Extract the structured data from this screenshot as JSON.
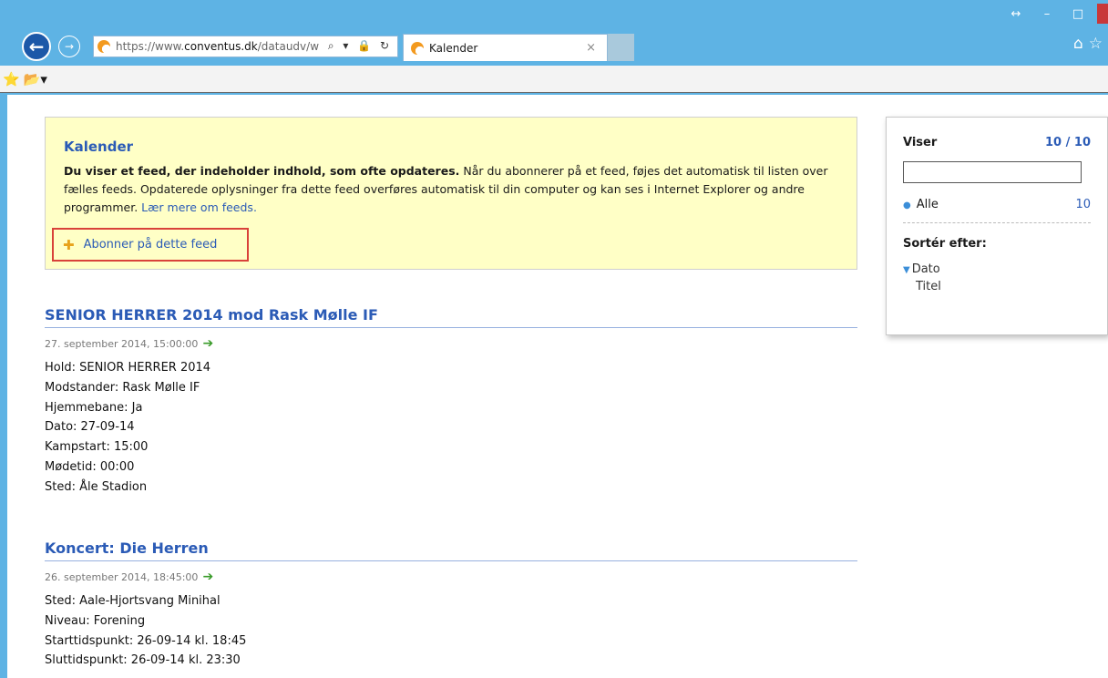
{
  "browser": {
    "url_prefix": "https://www.",
    "url_host": "conventus.dk",
    "url_path": "/dataudv/w",
    "tab_title": "Kalender",
    "tab_close": "×",
    "addr_icons": "⌕ ▾ 🔒 ↻",
    "back": "←",
    "forward": "→",
    "window_icons": [
      "↔",
      "–",
      "□"
    ]
  },
  "infobox": {
    "title": "Kalender",
    "bold_text": "Du viser et feed, der indeholder indhold, som ofte opdateres.",
    "text": " Når du abonnerer på et feed, føjes det automatisk til listen over fælles feeds. Opdaterede oplysninger fra dette feed overføres automatisk til din computer og kan ses i Internet Explorer og andre programmer. ",
    "link": "Lær mere om feeds.",
    "subscribe": "Abonner på dette feed"
  },
  "posts": [
    {
      "title": "SENIOR HERRER 2014 mod Rask Mølle IF",
      "date": "27. september 2014, 15:00:00",
      "lines": [
        "Hold: SENIOR HERRER 2014",
        "Modstander: Rask Mølle IF",
        "Hjemmebane: Ja",
        "Dato: 27-09-14",
        "Kampstart: 15:00",
        "Mødetid: 00:00",
        "Sted: Åle Stadion"
      ]
    },
    {
      "title": "Koncert: Die Herren",
      "date": "26. september 2014, 18:45:00",
      "lines": [
        "Sted: Aale-Hjortsvang Minihal",
        "Niveau: Forening",
        "Starttidspunkt: 26-09-14 kl. 18:45",
        "Sluttidspunkt: 26-09-14 kl. 23:30"
      ]
    }
  ],
  "sidebar": {
    "viser_label": "Viser",
    "viser_count": "10 / 10",
    "alle_label": "Alle",
    "alle_count": "10",
    "sort_label": "Sortér efter:",
    "sort_options": [
      "Dato",
      "Titel"
    ]
  }
}
